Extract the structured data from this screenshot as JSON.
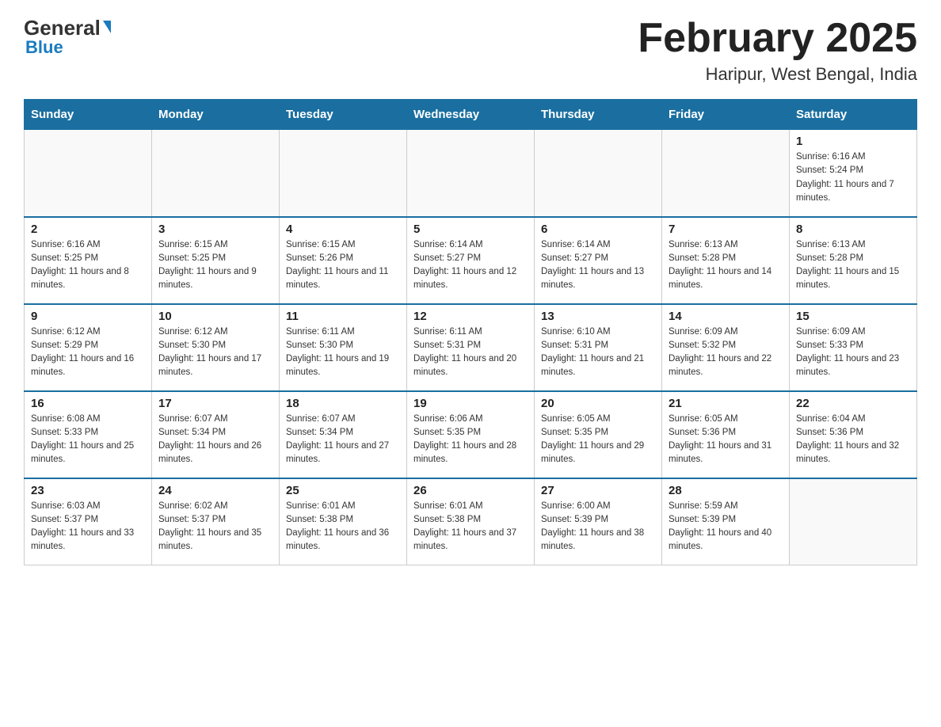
{
  "header": {
    "logo_general": "General",
    "logo_blue": "Blue",
    "month_title": "February 2025",
    "location": "Haripur, West Bengal, India"
  },
  "weekdays": [
    "Sunday",
    "Monday",
    "Tuesday",
    "Wednesday",
    "Thursday",
    "Friday",
    "Saturday"
  ],
  "weeks": [
    [
      {
        "day": "",
        "sunrise": "",
        "sunset": "",
        "daylight": ""
      },
      {
        "day": "",
        "sunrise": "",
        "sunset": "",
        "daylight": ""
      },
      {
        "day": "",
        "sunrise": "",
        "sunset": "",
        "daylight": ""
      },
      {
        "day": "",
        "sunrise": "",
        "sunset": "",
        "daylight": ""
      },
      {
        "day": "",
        "sunrise": "",
        "sunset": "",
        "daylight": ""
      },
      {
        "day": "",
        "sunrise": "",
        "sunset": "",
        "daylight": ""
      },
      {
        "day": "1",
        "sunrise": "Sunrise: 6:16 AM",
        "sunset": "Sunset: 5:24 PM",
        "daylight": "Daylight: 11 hours and 7 minutes."
      }
    ],
    [
      {
        "day": "2",
        "sunrise": "Sunrise: 6:16 AM",
        "sunset": "Sunset: 5:25 PM",
        "daylight": "Daylight: 11 hours and 8 minutes."
      },
      {
        "day": "3",
        "sunrise": "Sunrise: 6:15 AM",
        "sunset": "Sunset: 5:25 PM",
        "daylight": "Daylight: 11 hours and 9 minutes."
      },
      {
        "day": "4",
        "sunrise": "Sunrise: 6:15 AM",
        "sunset": "Sunset: 5:26 PM",
        "daylight": "Daylight: 11 hours and 11 minutes."
      },
      {
        "day": "5",
        "sunrise": "Sunrise: 6:14 AM",
        "sunset": "Sunset: 5:27 PM",
        "daylight": "Daylight: 11 hours and 12 minutes."
      },
      {
        "day": "6",
        "sunrise": "Sunrise: 6:14 AM",
        "sunset": "Sunset: 5:27 PM",
        "daylight": "Daylight: 11 hours and 13 minutes."
      },
      {
        "day": "7",
        "sunrise": "Sunrise: 6:13 AM",
        "sunset": "Sunset: 5:28 PM",
        "daylight": "Daylight: 11 hours and 14 minutes."
      },
      {
        "day": "8",
        "sunrise": "Sunrise: 6:13 AM",
        "sunset": "Sunset: 5:28 PM",
        "daylight": "Daylight: 11 hours and 15 minutes."
      }
    ],
    [
      {
        "day": "9",
        "sunrise": "Sunrise: 6:12 AM",
        "sunset": "Sunset: 5:29 PM",
        "daylight": "Daylight: 11 hours and 16 minutes."
      },
      {
        "day": "10",
        "sunrise": "Sunrise: 6:12 AM",
        "sunset": "Sunset: 5:30 PM",
        "daylight": "Daylight: 11 hours and 17 minutes."
      },
      {
        "day": "11",
        "sunrise": "Sunrise: 6:11 AM",
        "sunset": "Sunset: 5:30 PM",
        "daylight": "Daylight: 11 hours and 19 minutes."
      },
      {
        "day": "12",
        "sunrise": "Sunrise: 6:11 AM",
        "sunset": "Sunset: 5:31 PM",
        "daylight": "Daylight: 11 hours and 20 minutes."
      },
      {
        "day": "13",
        "sunrise": "Sunrise: 6:10 AM",
        "sunset": "Sunset: 5:31 PM",
        "daylight": "Daylight: 11 hours and 21 minutes."
      },
      {
        "day": "14",
        "sunrise": "Sunrise: 6:09 AM",
        "sunset": "Sunset: 5:32 PM",
        "daylight": "Daylight: 11 hours and 22 minutes."
      },
      {
        "day": "15",
        "sunrise": "Sunrise: 6:09 AM",
        "sunset": "Sunset: 5:33 PM",
        "daylight": "Daylight: 11 hours and 23 minutes."
      }
    ],
    [
      {
        "day": "16",
        "sunrise": "Sunrise: 6:08 AM",
        "sunset": "Sunset: 5:33 PM",
        "daylight": "Daylight: 11 hours and 25 minutes."
      },
      {
        "day": "17",
        "sunrise": "Sunrise: 6:07 AM",
        "sunset": "Sunset: 5:34 PM",
        "daylight": "Daylight: 11 hours and 26 minutes."
      },
      {
        "day": "18",
        "sunrise": "Sunrise: 6:07 AM",
        "sunset": "Sunset: 5:34 PM",
        "daylight": "Daylight: 11 hours and 27 minutes."
      },
      {
        "day": "19",
        "sunrise": "Sunrise: 6:06 AM",
        "sunset": "Sunset: 5:35 PM",
        "daylight": "Daylight: 11 hours and 28 minutes."
      },
      {
        "day": "20",
        "sunrise": "Sunrise: 6:05 AM",
        "sunset": "Sunset: 5:35 PM",
        "daylight": "Daylight: 11 hours and 29 minutes."
      },
      {
        "day": "21",
        "sunrise": "Sunrise: 6:05 AM",
        "sunset": "Sunset: 5:36 PM",
        "daylight": "Daylight: 11 hours and 31 minutes."
      },
      {
        "day": "22",
        "sunrise": "Sunrise: 6:04 AM",
        "sunset": "Sunset: 5:36 PM",
        "daylight": "Daylight: 11 hours and 32 minutes."
      }
    ],
    [
      {
        "day": "23",
        "sunrise": "Sunrise: 6:03 AM",
        "sunset": "Sunset: 5:37 PM",
        "daylight": "Daylight: 11 hours and 33 minutes."
      },
      {
        "day": "24",
        "sunrise": "Sunrise: 6:02 AM",
        "sunset": "Sunset: 5:37 PM",
        "daylight": "Daylight: 11 hours and 35 minutes."
      },
      {
        "day": "25",
        "sunrise": "Sunrise: 6:01 AM",
        "sunset": "Sunset: 5:38 PM",
        "daylight": "Daylight: 11 hours and 36 minutes."
      },
      {
        "day": "26",
        "sunrise": "Sunrise: 6:01 AM",
        "sunset": "Sunset: 5:38 PM",
        "daylight": "Daylight: 11 hours and 37 minutes."
      },
      {
        "day": "27",
        "sunrise": "Sunrise: 6:00 AM",
        "sunset": "Sunset: 5:39 PM",
        "daylight": "Daylight: 11 hours and 38 minutes."
      },
      {
        "day": "28",
        "sunrise": "Sunrise: 5:59 AM",
        "sunset": "Sunset: 5:39 PM",
        "daylight": "Daylight: 11 hours and 40 minutes."
      },
      {
        "day": "",
        "sunrise": "",
        "sunset": "",
        "daylight": ""
      }
    ]
  ]
}
